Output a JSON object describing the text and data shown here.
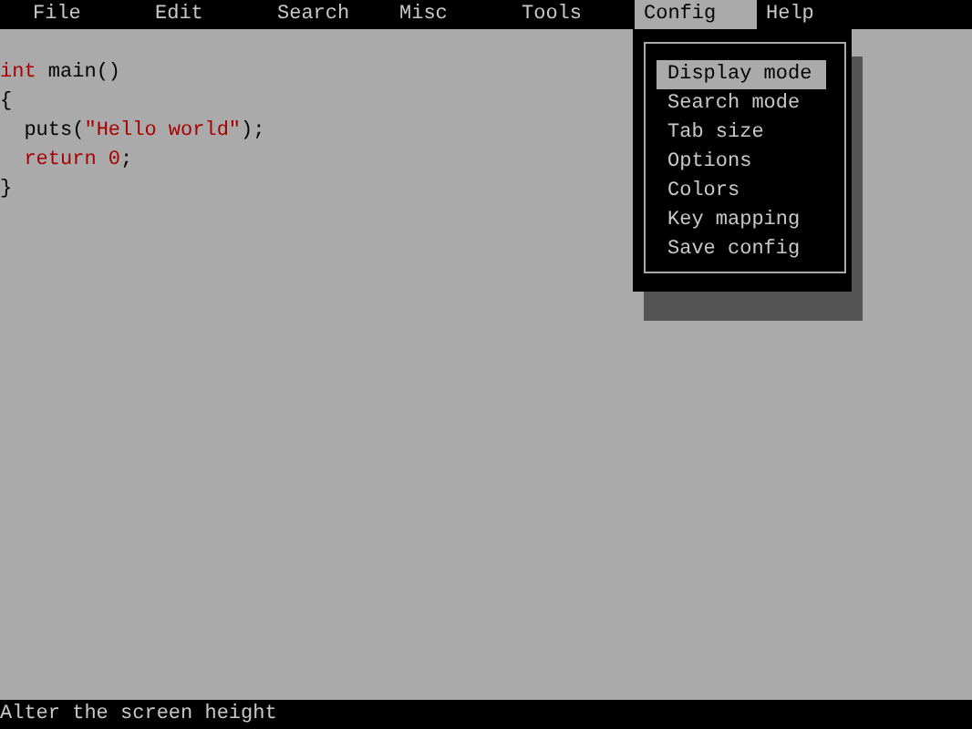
{
  "menu_bar": [
    {
      "label": "File",
      "selected": false
    },
    {
      "label": "Edit",
      "selected": false
    },
    {
      "label": "Search",
      "selected": false
    },
    {
      "label": "Misc",
      "selected": false
    },
    {
      "label": "Tools",
      "selected": false
    },
    {
      "label": "Config",
      "selected": true
    },
    {
      "label": "Help",
      "selected": false
    }
  ],
  "editor": {
    "lines": [
      [
        {
          "kind": "keyword",
          "text": "int"
        },
        {
          "kind": "plain",
          "text": " main()"
        }
      ],
      [
        {
          "kind": "plain",
          "text": "{"
        }
      ],
      [
        {
          "kind": "plain",
          "text": "  puts("
        },
        {
          "kind": "string",
          "text": "\"Hello world\""
        },
        {
          "kind": "plain",
          "text": ");"
        }
      ],
      [
        {
          "kind": "keyword",
          "text": "  return 0"
        },
        {
          "kind": "plain",
          "text": ";"
        }
      ],
      [
        {
          "kind": "plain",
          "text": "}"
        }
      ]
    ]
  },
  "config_menu": {
    "items": [
      {
        "label": "Display mode",
        "selected": true
      },
      {
        "label": "Search mode",
        "selected": false
      },
      {
        "label": "Tab size",
        "selected": false
      },
      {
        "label": "Options",
        "selected": false
      },
      {
        "label": "Colors",
        "selected": false
      },
      {
        "label": "Key mapping",
        "selected": false
      },
      {
        "label": "Save config",
        "selected": false
      }
    ]
  },
  "status_bar": {
    "text": "Alter the screen height"
  }
}
